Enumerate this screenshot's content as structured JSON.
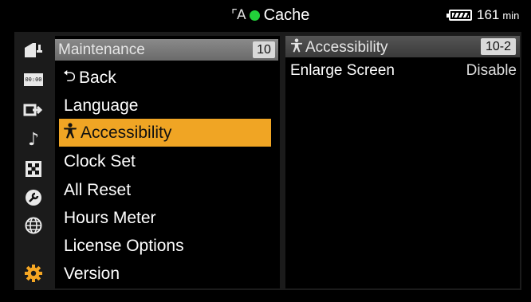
{
  "status_bar": {
    "media_icon": "card-icon",
    "rec_dot_color": "#22d13a",
    "title": "Cache",
    "battery_icon": "battery-icon",
    "battery_value": "161",
    "battery_unit": "min"
  },
  "categories": [
    {
      "icon": "camera-icon"
    },
    {
      "icon": "timecode-icon"
    },
    {
      "icon": "output-icon"
    },
    {
      "icon": "music-note-icon"
    },
    {
      "icon": "checker-icon"
    },
    {
      "icon": "wrench-icon"
    },
    {
      "icon": "globe-icon"
    },
    {
      "icon": "gear-icon",
      "active": true
    }
  ],
  "menu": {
    "header": {
      "title": "Maintenance",
      "badge": "10"
    },
    "items": [
      {
        "label": "Back",
        "icon": "back-arrow-icon"
      },
      {
        "label": "Language"
      },
      {
        "label": "Accessibility",
        "icon": "person-icon",
        "selected": true
      },
      {
        "label": "Clock Set"
      },
      {
        "label": "All Reset"
      },
      {
        "label": "Hours Meter"
      },
      {
        "label": "License Options"
      },
      {
        "label": "Version"
      }
    ]
  },
  "detail": {
    "header": {
      "title": "Accessibility",
      "icon": "person-icon",
      "badge": "10-2"
    },
    "rows": [
      {
        "label": "Enlarge Screen",
        "value": "Disable"
      }
    ]
  },
  "colors": {
    "accent": "#f0a524",
    "background": "#000000",
    "frame": "#1b1b1b"
  }
}
